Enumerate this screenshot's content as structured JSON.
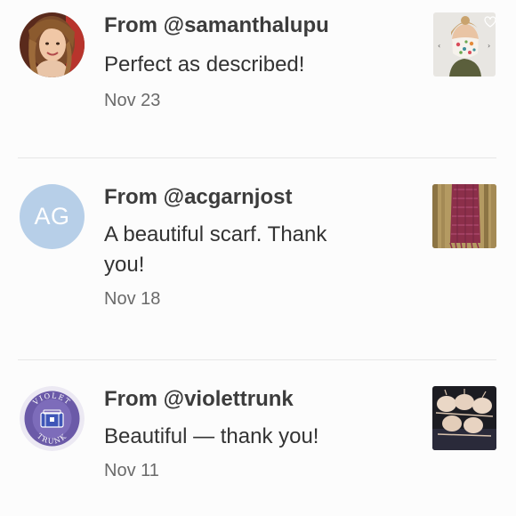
{
  "reviews": [
    {
      "from": "From @samanthalupu",
      "comment": "Perfect as described!",
      "date": "Nov 23",
      "avatar_icon": "user-photo-avatar",
      "thumbnail_icon": "face-mask-listing-thumbnail"
    },
    {
      "from": "From @acgarnjost",
      "comment": "A beautiful scarf. Thank you!",
      "date": "Nov 18",
      "avatar_initials": "AG",
      "avatar_color": "#b7cfe8",
      "thumbnail_icon": "scarf-listing-thumbnail"
    },
    {
      "from": "From @violettrunk",
      "comment": "Beautiful — thank you!",
      "date": "Nov 11",
      "avatar_icon": "violet-trunk-logo-avatar",
      "thumbnail_icon": "bras-listing-thumbnail"
    }
  ],
  "logo_text": {
    "top": "VIOLET",
    "bottom": "TRUNK"
  }
}
